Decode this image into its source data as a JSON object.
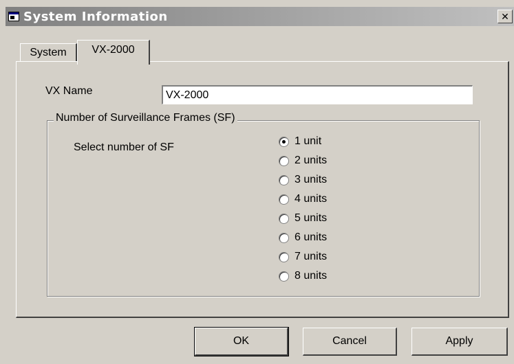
{
  "window": {
    "title": "System Information",
    "close_glyph": "✕"
  },
  "tabs": [
    {
      "label": "System",
      "active": false
    },
    {
      "label": "VX-2000",
      "active": true
    }
  ],
  "form": {
    "vx_name_label": "VX Name",
    "vx_name_value": "VX-2000"
  },
  "group": {
    "legend": "Number of Surveillance Frames (SF)",
    "select_label": "Select number of SF",
    "options": [
      {
        "label": "1 unit",
        "checked": true
      },
      {
        "label": "2 units",
        "checked": false
      },
      {
        "label": "3 units",
        "checked": false
      },
      {
        "label": "4 units",
        "checked": false
      },
      {
        "label": "5 units",
        "checked": false
      },
      {
        "label": "6 units",
        "checked": false
      },
      {
        "label": "7 units",
        "checked": false
      },
      {
        "label": "8 units",
        "checked": false
      }
    ]
  },
  "buttons": {
    "ok": "OK",
    "cancel": "Cancel",
    "apply": "Apply"
  },
  "icons": {
    "title": "window-app-icon",
    "close": "close-icon",
    "radio": "radio-icon"
  },
  "colors": {
    "face": "#d4d0c8",
    "title_start": "#808080",
    "title_end": "#c0c0c0"
  }
}
